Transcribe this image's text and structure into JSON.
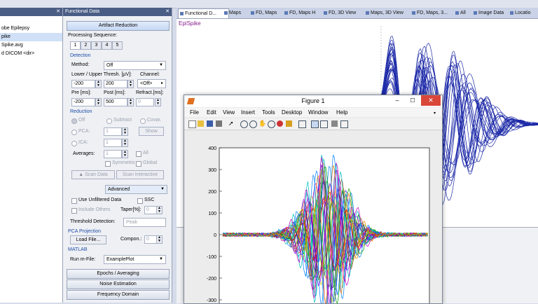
{
  "file_panel": {
    "title": "",
    "items": [
      "",
      "obe Epilepsy",
      "pike",
      "Spike.avg",
      "d DICOM <dir>"
    ]
  },
  "functional_panel": {
    "title": "Functional Data",
    "artifact_button": "Artifact Reduction",
    "processing_label": "Processing Sequence:",
    "tabs": [
      "1",
      "2",
      "3",
      "4",
      "5"
    ],
    "detection": {
      "header": "Detection",
      "method_label": "Method:",
      "method_value": "Off",
      "thresh_label": "Lower / Upper Thresh. [µV]:",
      "lower": "-200",
      "upper": "200",
      "channel_label": "Channel:",
      "channel_value": "<Off>",
      "pre_label": "Pre [ms]:",
      "post_label": "Post [ms]:",
      "refract_label": "Refract.[ms]:",
      "pre": "-200",
      "post": "500",
      "refract": "0"
    },
    "reduction": {
      "header": "Reduction",
      "off": "Off",
      "subtract": "Subtract",
      "covar": "Covar.",
      "pca": "PCA:",
      "pca_val": "1",
      "show": "Show",
      "ica": "ICA:",
      "ica_val": "1",
      "averages": "Averages:",
      "avg_val": "1",
      "all": "All",
      "symmetric": "Symmetric",
      "global": "Global",
      "scan_data": "Scan Data",
      "scan_interactive": "Scan Interactive"
    },
    "advanced": "Advanced",
    "use_unfiltered": "Use Unfiltered Data",
    "ssc": "SSC",
    "include_others": "Include Others",
    "taper_label": "Taper[%]:",
    "taper_val": "0",
    "threshold_detection_label": "Threshold Detection:",
    "threshold_detection_val": "Peak",
    "pca_projection": "PCA Projection",
    "load_file": "Load File...",
    "compon_label": "Compon.:",
    "compon_val": "0",
    "matlab_header": "MATLAB",
    "run_mfile_label": "Run m-File:",
    "run_mfile_val": "ExamplePlot",
    "epochs": "Epochs / Averaging",
    "noise": "Noise Estimation",
    "frequency": "Frequency Domain"
  },
  "tabs": [
    "Functional D...",
    "Maps",
    "FD, Maps",
    "FD, Maps H",
    "FD, 3D View",
    "Maps, 3D View",
    "FD, Maps, 3...",
    "All",
    "Image Data",
    "Locatio"
  ],
  "view": {
    "label": "EpiSpike"
  },
  "figure": {
    "title": "Figure 1",
    "menu": [
      "File",
      "Edit",
      "View",
      "Insert",
      "Tools",
      "Desktop",
      "Window",
      "Help"
    ],
    "yticks": [
      "400",
      "300",
      "200",
      "100",
      "0",
      "-100",
      "-200",
      "-300"
    ]
  },
  "colors": {
    "panel_title": "#4a5d85",
    "accent_blue": "#1f4ea8",
    "close_red": "#d9463a",
    "trace_blue": "#1d2aa8"
  }
}
